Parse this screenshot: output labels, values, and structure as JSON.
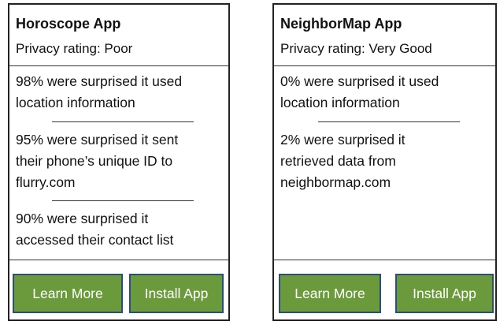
{
  "apps": [
    {
      "title": "Horoscope App",
      "rating": "Privacy rating: Poor",
      "stats": [
        "98% were surprised it used\nlocation information",
        "95% were surprised it sent\ntheir phone’s unique ID to\nflurry.com",
        "90% were surprised it\naccessed their contact list"
      ],
      "buttons": {
        "learn_more": "Learn More",
        "install": "Install App"
      }
    },
    {
      "title": "NeighborMap App",
      "rating": "Privacy rating: Very Good",
      "stats": [
        "0% were surprised it used\nlocation information",
        "2% were surprised it\nretrieved data from\nneighbormap.com"
      ],
      "buttons": {
        "learn_more": "Learn More",
        "install": "Install App"
      }
    }
  ],
  "colors": {
    "button_fill": "#6a9a3b",
    "button_border": "#2b4f7a",
    "card_border": "#222222"
  }
}
